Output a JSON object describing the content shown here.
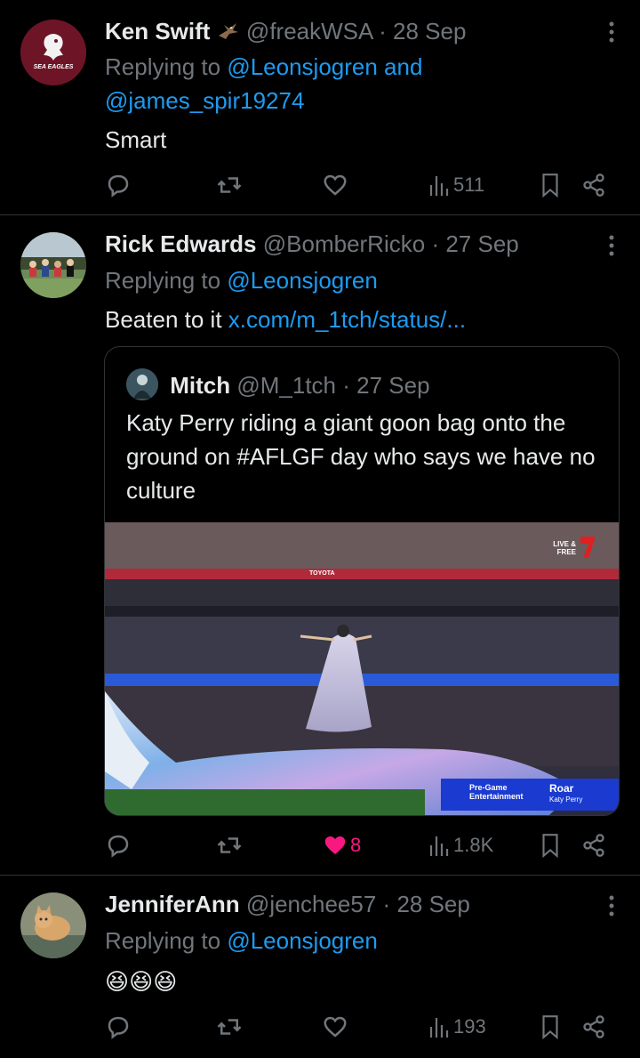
{
  "tweets": [
    {
      "name": "Ken Swift",
      "handle": "@freakWSA",
      "date": "28 Sep",
      "replying_prefix": "Replying to ",
      "replying_to": "@Leonsjogren and @james_spir19274",
      "text": "Smart",
      "likes": "",
      "views": "511",
      "avatar_text": "SEA EAGLES"
    },
    {
      "name": "Rick Edwards",
      "handle": "@BomberRicko",
      "date": "27 Sep",
      "replying_prefix": "Replying to ",
      "replying_to": "@Leonsjogren",
      "text_prefix": "Beaten to it ",
      "text_link": "x.com/m_1tch/status/...",
      "likes": "8",
      "views": "1.8K",
      "quote": {
        "name": "Mitch",
        "handle": "@M_1tch",
        "date": "27 Sep",
        "text": "Katy Perry riding a giant goon bag onto the ground on #AFLGF day who says we have no culture",
        "media": {
          "banner": "TOYOTA",
          "badge": "LIVE & FREE",
          "lower_third_left": "Pre-Game Entertainment",
          "lower_third_title": "Roar",
          "lower_third_sub": "Katy Perry"
        }
      }
    },
    {
      "name": "JenniferAnn",
      "handle": "@jenchee57",
      "date": "28 Sep",
      "replying_prefix": "Replying to ",
      "replying_to": "@Leonsjogren",
      "text": "😆😆😆",
      "likes": "",
      "views": "193"
    }
  ],
  "colors": {
    "background": "#000000",
    "text": "#e7e9ea",
    "secondary": "#71767b",
    "link": "#1d9bf0",
    "like_active": "#f91880",
    "divider": "#2f3336"
  },
  "icons": [
    "reply-icon",
    "retweet-icon",
    "like-icon",
    "views-icon",
    "bookmark-icon",
    "share-icon",
    "more-icon",
    "eagle-emoji-icon"
  ]
}
